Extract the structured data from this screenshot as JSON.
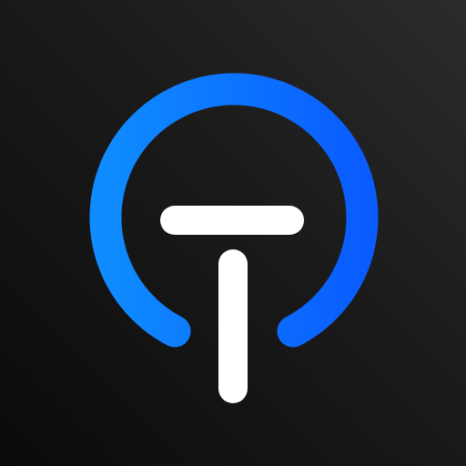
{
  "app_icon": {
    "icon_name": "t-logo-icon",
    "colors": {
      "background_dark": "#0b0b0b",
      "background_light": "#2b2b2b",
      "ring_start": "#0f8cff",
      "ring_end": "#0a5cff",
      "letter": "#ffffff"
    }
  }
}
